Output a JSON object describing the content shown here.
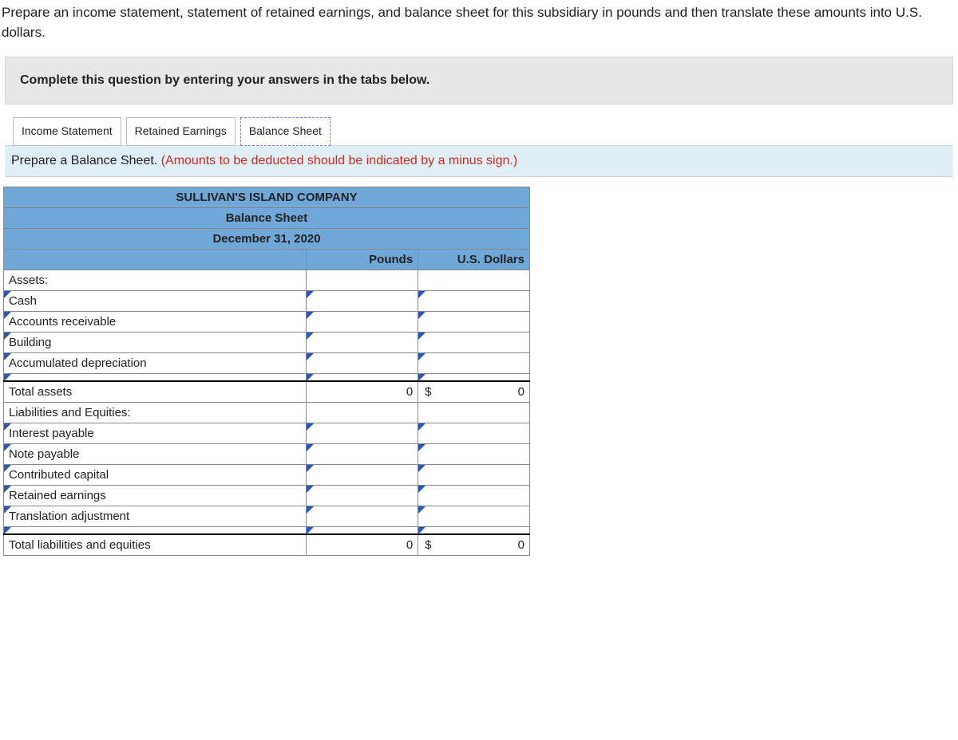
{
  "instructions": "Prepare an income statement, statement of retained earnings, and balance sheet for this subsidiary in pounds and then translate these amounts into U.S. dollars.",
  "banner": "Complete this question by entering your answers in the tabs below.",
  "tabs": {
    "income": "Income Statement",
    "retained": "Retained Earnings",
    "balance": "Balance Sheet"
  },
  "hint": {
    "prefix": "Prepare a Balance Sheet. ",
    "red": "(Amounts to be deducted should be indicated by a minus sign.)"
  },
  "sheet": {
    "company": "SULLIVAN'S ISLAND COMPANY",
    "title": "Balance Sheet",
    "date": "December 31, 2020",
    "col_pounds": "Pounds",
    "col_dollars": "U.S. Dollars",
    "sections": {
      "assets_header": "Assets:",
      "assets_rows": [
        "Cash",
        "Accounts receivable",
        "Building",
        "Accumulated depreciation",
        ""
      ],
      "total_assets": "Total assets",
      "total_assets_pounds": "0",
      "total_assets_dollars": "0",
      "liab_header": "Liabilities and Equities:",
      "liab_rows": [
        "Interest payable",
        "Note payable",
        "Contributed capital",
        "Retained earnings",
        "Translation adjustment",
        ""
      ],
      "total_liab": "Total liabilities and equities",
      "total_liab_pounds": "0",
      "total_liab_dollars": "0",
      "currency_symbol": "$"
    }
  }
}
